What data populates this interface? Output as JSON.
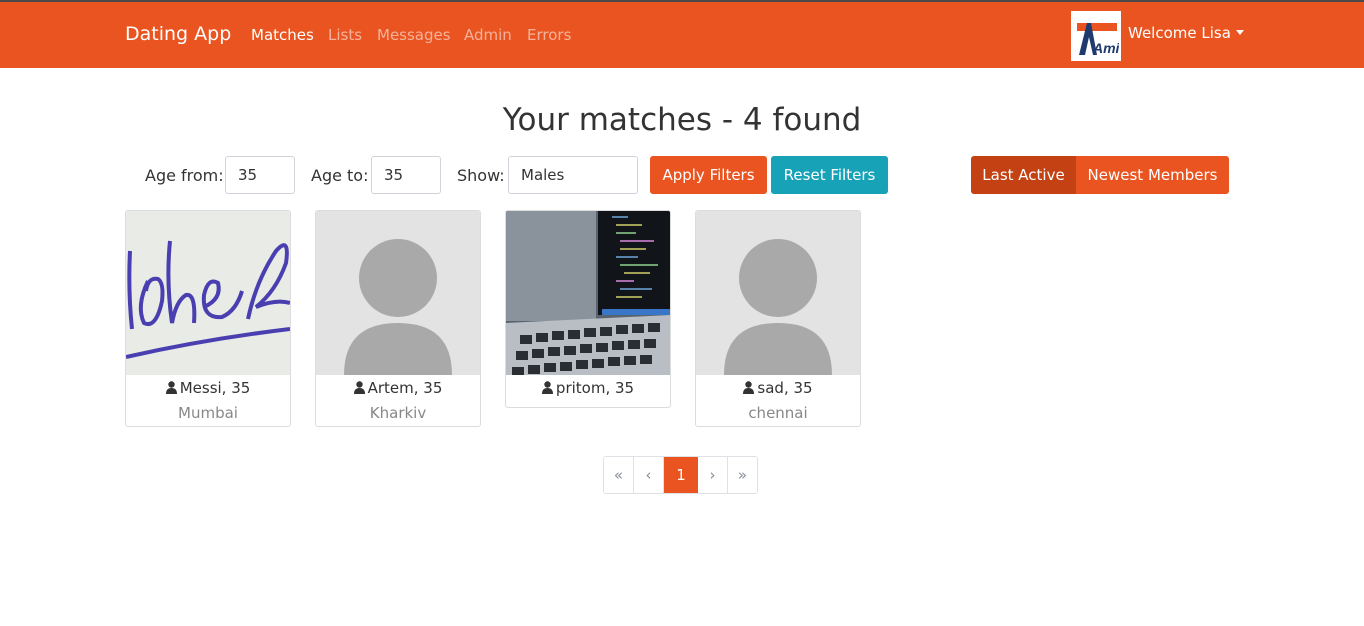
{
  "navbar": {
    "brand": "Dating App",
    "links": [
      {
        "label": "Matches",
        "active": true
      },
      {
        "label": "Lists",
        "active": false
      },
      {
        "label": "Messages",
        "active": false
      },
      {
        "label": "Admin",
        "active": false
      },
      {
        "label": "Errors",
        "active": false
      }
    ],
    "welcome": "Welcome Lisa",
    "avatar_text": "Amir"
  },
  "heading": "Your matches - 4 found",
  "filters": {
    "age_from_label": "Age from:",
    "age_from_value": "35",
    "age_to_label": "Age to:",
    "age_to_value": "35",
    "show_label": "Show:",
    "show_value": "Males",
    "apply_label": "Apply Filters",
    "reset_label": "Reset Filters",
    "sort_last_active": "Last Active",
    "sort_newest": "Newest Members"
  },
  "members": [
    {
      "name_age": "Messi, 35",
      "city": "Mumbai",
      "photo": "handwriting"
    },
    {
      "name_age": "Artem, 35",
      "city": "Kharkiv",
      "photo": "default-avatar"
    },
    {
      "name_age": "pritom, 35",
      "city": "",
      "photo": "laptop-code"
    },
    {
      "name_age": "sad, 35",
      "city": "chennai",
      "photo": "default-avatar"
    }
  ],
  "pagination": {
    "first": "«",
    "prev": "‹",
    "current": "1",
    "next": "›",
    "last": "»"
  },
  "colors": {
    "primary": "#e95420",
    "info": "#17a2b8",
    "active_sort": "#c34113"
  }
}
